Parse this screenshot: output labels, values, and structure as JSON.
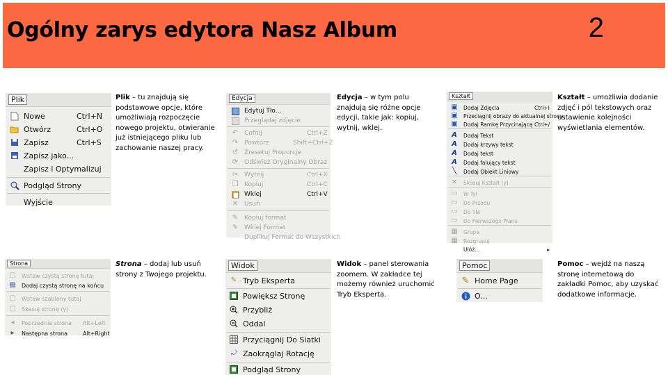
{
  "header": {
    "title": "Ogólny zarys edytora Nasz Album",
    "page_number": "2"
  },
  "panels": {
    "plik": {
      "menu_title": "Plik",
      "items": [
        {
          "label": "Nowe",
          "shortcut": "Ctrl+N",
          "icon": "new-file-icon"
        },
        {
          "label": "Otwórz",
          "shortcut": "Ctrl+O",
          "icon": "folder-open-icon"
        },
        {
          "label": "Zapisz",
          "shortcut": "Ctrl+S",
          "icon": "save-icon"
        },
        {
          "label": "Zapisz jako...",
          "shortcut": "",
          "icon": "save-as-icon"
        },
        {
          "label": "Zapisz i Optymalizuj",
          "shortcut": "",
          "icon": ""
        },
        {
          "label": "Podgląd Strony",
          "shortcut": "",
          "icon": "preview-icon"
        },
        {
          "label": "Wyjście",
          "shortcut": "",
          "icon": ""
        }
      ],
      "description": {
        "name": "Plik",
        "text": " – tu znajdują się podstawowe opcje, które umożliwiają rozpoczęcie nowego projektu, otwieranie już istniejącego pliku lub zachowanie naszej pracy."
      }
    },
    "edycja": {
      "menu_title": "Edycja",
      "items": [
        {
          "label": "Edytuj Tło...",
          "shortcut": "",
          "icon": "background-icon"
        },
        {
          "label": "Przeglądaj zdjęcie",
          "shortcut": "",
          "icon": "browse-icon"
        },
        {
          "label": "Cofnij",
          "shortcut": "Ctrl+Z",
          "icon": "undo-icon"
        },
        {
          "label": "Powtórz",
          "shortcut": "Shift+Ctrl+Z",
          "icon": "redo-icon"
        },
        {
          "label": "Zresetuj Proporcje",
          "shortcut": "",
          "icon": "reset-icon"
        },
        {
          "label": "Odśwież Oryginalny Obraz",
          "shortcut": "",
          "icon": "refresh-icon"
        },
        {
          "label": "Wytnij",
          "shortcut": "Ctrl+X",
          "icon": "cut-icon"
        },
        {
          "label": "Kopiuj",
          "shortcut": "Ctrl+C",
          "icon": "copy-icon"
        },
        {
          "label": "Wklej",
          "shortcut": "Ctrl+V",
          "icon": "paste-icon"
        },
        {
          "label": "Usuń",
          "shortcut": "",
          "icon": "delete-icon"
        },
        {
          "label": "Kopiuj format",
          "shortcut": "",
          "icon": "copy-format-icon"
        },
        {
          "label": "Wklej Format",
          "shortcut": "",
          "icon": "paste-format-icon"
        },
        {
          "label": "Duplikuj Format do Wszystkich",
          "shortcut": "",
          "icon": ""
        }
      ],
      "description": {
        "name": "Edycja",
        "text": " – w tym polu znajdują się różne opcje edycji, takie jak: kopiuj, wytnij, wklej."
      }
    },
    "ksztalt": {
      "menu_title": "Kształt",
      "items": [
        {
          "label": "Dodaj Zdjęcia",
          "shortcut": "Ctrl+I",
          "icon": "add-photo-icon"
        },
        {
          "label": "Przeciągnij obrazy do aktualnej strony",
          "shortcut": "",
          "icon": "drag-image-icon"
        },
        {
          "label": "Dodaj Ramkę Przycinającą",
          "shortcut": "Ctrl+/",
          "icon": "crop-frame-icon"
        },
        {
          "label": "Dodaj Tekst",
          "shortcut": "",
          "icon": "text-icon"
        },
        {
          "label": "Dodaj krzywy tekst",
          "shortcut": "",
          "icon": "curved-text-icon"
        },
        {
          "label": "Dodaj tekst",
          "shortcut": "",
          "icon": "text-icon"
        },
        {
          "label": "Dodaj falujący tekst",
          "shortcut": "",
          "icon": "wave-text-icon"
        },
        {
          "label": "Dodaj Obiekt Liniowy",
          "shortcut": "",
          "icon": "line-icon"
        },
        {
          "label": "Skasuj Kształt (y)",
          "shortcut": "",
          "icon": "delete-shape-icon"
        },
        {
          "label": "W Tył",
          "shortcut": "",
          "icon": "back-icon"
        },
        {
          "label": "Do Przodu",
          "shortcut": "",
          "icon": "forward-icon"
        },
        {
          "label": "Do Tła",
          "shortcut": "",
          "icon": "to-back-icon"
        },
        {
          "label": "Do Pierwszego Planu",
          "shortcut": "",
          "icon": "to-front-icon"
        },
        {
          "label": "Grupa",
          "shortcut": "",
          "icon": "group-icon"
        },
        {
          "label": "Rozgrupuj",
          "shortcut": "",
          "icon": "ungroup-icon"
        },
        {
          "label": "Ułóż...",
          "shortcut": "",
          "icon": ""
        }
      ],
      "description": {
        "name": "Kształt",
        "text": " – umożliwia dodanie zdjęć i pól tekstowych oraz ustawienie kolejności wyświetlania elementów."
      }
    },
    "strona": {
      "menu_title": "Strona",
      "items": [
        {
          "label": "Wstaw czystą stronę tutaj",
          "shortcut": "",
          "icon": "insert-page-icon"
        },
        {
          "label": "Dodaj czystą stronę na końcu",
          "shortcut": "",
          "icon": "add-page-icon"
        },
        {
          "label": "Wstaw szablony tutaj",
          "shortcut": "",
          "icon": "template-icon"
        },
        {
          "label": "Skasuj stronę (y)",
          "shortcut": "",
          "icon": "delete-page-icon"
        },
        {
          "label": "Poprzednia strona",
          "shortcut": "Alt+Left",
          "icon": "prev-page-icon"
        },
        {
          "label": "Następna strona",
          "shortcut": "Alt+Right",
          "icon": "next-page-icon"
        }
      ],
      "description": {
        "name": "Strona",
        "text": " – dodaj lub usuń strony z Twojego projektu."
      }
    },
    "widok": {
      "menu_title": "Widok",
      "items": [
        {
          "label": "Tryb Eksperta",
          "shortcut": "",
          "icon": "expert-mode-icon"
        },
        {
          "label": "Powiększ Stronę",
          "shortcut": "",
          "icon": "zoom-page-icon"
        },
        {
          "label": "Przybliż",
          "shortcut": "",
          "icon": "zoom-in-icon"
        },
        {
          "label": "Oddal",
          "shortcut": "",
          "icon": "zoom-out-icon"
        },
        {
          "label": "Przyciągnij Do Siatki",
          "shortcut": "",
          "icon": "grid-icon"
        },
        {
          "label": "Zaokrąglaj Rotację",
          "shortcut": "",
          "icon": "rotate-icon"
        },
        {
          "label": "Podgląd Strony",
          "shortcut": "",
          "icon": "preview-icon"
        }
      ],
      "description": {
        "name": "Widok",
        "text": " – panel sterowania zoomem. W zakładce tej możemy również uruchomić Tryb Eksperta."
      }
    },
    "pomoc": {
      "menu_title": "Pomoc",
      "items": [
        {
          "label": "Home Page",
          "shortcut": "",
          "icon": "home-page-icon"
        },
        {
          "label": "O...",
          "shortcut": "",
          "icon": "info-icon"
        }
      ],
      "description": {
        "name": "Pomoc",
        "text": " – wejdź na naszą stronę internetową do zakładki Pomoc, aby uzyskać dodatkowe informacje."
      }
    }
  },
  "colors": {
    "header_bg": "#fb6841",
    "menu_bg": "#eeeeec",
    "disabled_text": "#a4a4a4"
  }
}
